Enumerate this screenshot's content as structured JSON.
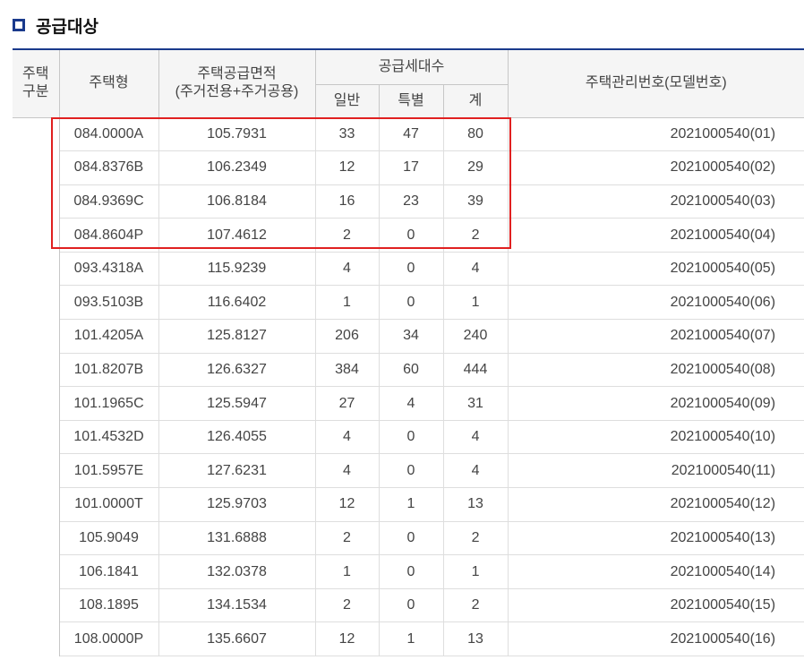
{
  "section": {
    "title": "공급대상",
    "icon": "square-bullet-icon"
  },
  "headers": {
    "type_group": "주택\n구분",
    "housing_type": "주택형",
    "area": "주택공급면적\n(주거전용+주거공용)",
    "units": "공급세대수",
    "general": "일반",
    "special": "특별",
    "total": "계",
    "model": "주택관리번호(모델번호)"
  },
  "rows": [
    {
      "type": "084.0000A",
      "area": "105.7931",
      "general": "33",
      "special": "47",
      "total": "80",
      "model": "2021000540(01)"
    },
    {
      "type": "084.8376B",
      "area": "106.2349",
      "general": "12",
      "special": "17",
      "total": "29",
      "model": "2021000540(02)"
    },
    {
      "type": "084.9369C",
      "area": "106.8184",
      "general": "16",
      "special": "23",
      "total": "39",
      "model": "2021000540(03)"
    },
    {
      "type": "084.8604P",
      "area": "107.4612",
      "general": "2",
      "special": "0",
      "total": "2",
      "model": "2021000540(04)"
    },
    {
      "type": "093.4318A",
      "area": "115.9239",
      "general": "4",
      "special": "0",
      "total": "4",
      "model": "2021000540(05)"
    },
    {
      "type": "093.5103B",
      "area": "116.6402",
      "general": "1",
      "special": "0",
      "total": "1",
      "model": "2021000540(06)"
    },
    {
      "type": "101.4205A",
      "area": "125.8127",
      "general": "206",
      "special": "34",
      "total": "240",
      "model": "2021000540(07)"
    },
    {
      "type": "101.8207B",
      "area": "126.6327",
      "general": "384",
      "special": "60",
      "total": "444",
      "model": "2021000540(08)"
    },
    {
      "type": "101.1965C",
      "area": "125.5947",
      "general": "27",
      "special": "4",
      "total": "31",
      "model": "2021000540(09)"
    },
    {
      "type": "101.4532D",
      "area": "126.4055",
      "general": "4",
      "special": "0",
      "total": "4",
      "model": "2021000540(10)"
    },
    {
      "type": "101.5957E",
      "area": "127.6231",
      "general": "4",
      "special": "0",
      "total": "4",
      "model": "2021000540(11)"
    },
    {
      "type": "101.0000T",
      "area": "125.9703",
      "general": "12",
      "special": "1",
      "total": "13",
      "model": "2021000540(12)"
    },
    {
      "type": "105.9049",
      "area": "131.6888",
      "general": "2",
      "special": "0",
      "total": "2",
      "model": "2021000540(13)"
    },
    {
      "type": "106.1841",
      "area": "132.0378",
      "general": "1",
      "special": "0",
      "total": "1",
      "model": "2021000540(14)"
    },
    {
      "type": "108.1895",
      "area": "134.1534",
      "general": "2",
      "special": "0",
      "total": "2",
      "model": "2021000540(15)"
    },
    {
      "type": "108.0000P",
      "area": "135.6607",
      "general": "12",
      "special": "1",
      "total": "13",
      "model": "2021000540(16)"
    }
  ],
  "group_starts": [
    1,
    4,
    5,
    9,
    13
  ],
  "highlight_color": "#e02020",
  "accent_color": "#1a3a8c"
}
